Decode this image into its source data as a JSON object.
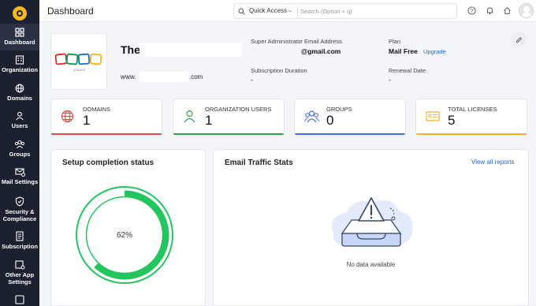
{
  "app": {
    "logo_icon": "zoho-mail-admin-logo-icon"
  },
  "sidebar": {
    "items": [
      {
        "label": "Dashboard",
        "icon": "dashboard-icon",
        "active": true
      },
      {
        "label": "Organization",
        "icon": "organization-icon"
      },
      {
        "label": "Domains",
        "icon": "globe-icon"
      },
      {
        "label": "Users",
        "icon": "user-icon"
      },
      {
        "label": "Groups",
        "icon": "groups-icon"
      },
      {
        "label": "Mail Settings",
        "icon": "mail-settings-icon"
      },
      {
        "label": "Security & Compliance",
        "icon": "shield-icon"
      },
      {
        "label": "Subscription",
        "icon": "subscription-icon"
      },
      {
        "label": "Other App Settings",
        "icon": "apps-icon"
      }
    ]
  },
  "topbar": {
    "title": "Dashboard",
    "quick_access_label": "Quick Access",
    "search_placeholder": "Search (Option + q)"
  },
  "org": {
    "logo_text": "ZOHO",
    "name": "The",
    "domain_prefix": "www.",
    "domain_suffix": ".com",
    "super_admin_label": "Super Administrator Email Address",
    "super_admin_value": "@gmail.com",
    "plan_label": "Plan",
    "plan_value": "Mail Free",
    "upgrade_label": "Upgrade",
    "subscription_duration_label": "Subscription Duration",
    "subscription_duration_value": "-",
    "renewal_date_label": "Renewal Date",
    "renewal_date_value": "-"
  },
  "stats": [
    {
      "label": "DOMAINS",
      "value": "1",
      "color": "#e5484d",
      "icon": "globe-icon"
    },
    {
      "label": "ORGANIZATION USERS",
      "value": "1",
      "color": "#2ea44f",
      "icon": "user-icon"
    },
    {
      "label": "GROUPS",
      "value": "0",
      "color": "#4a6ee0",
      "icon": "groups-icon"
    },
    {
      "label": "TOTAL LICENSES",
      "value": "5",
      "color": "#f0b429",
      "icon": "license-icon"
    }
  ],
  "setup": {
    "title": "Setup completion status",
    "percent_label": "62%",
    "percent": 62,
    "color": "#22c55e"
  },
  "email_traffic": {
    "title": "Email Traffic Stats",
    "link_label": "View all reports",
    "empty_text": "No data available"
  }
}
